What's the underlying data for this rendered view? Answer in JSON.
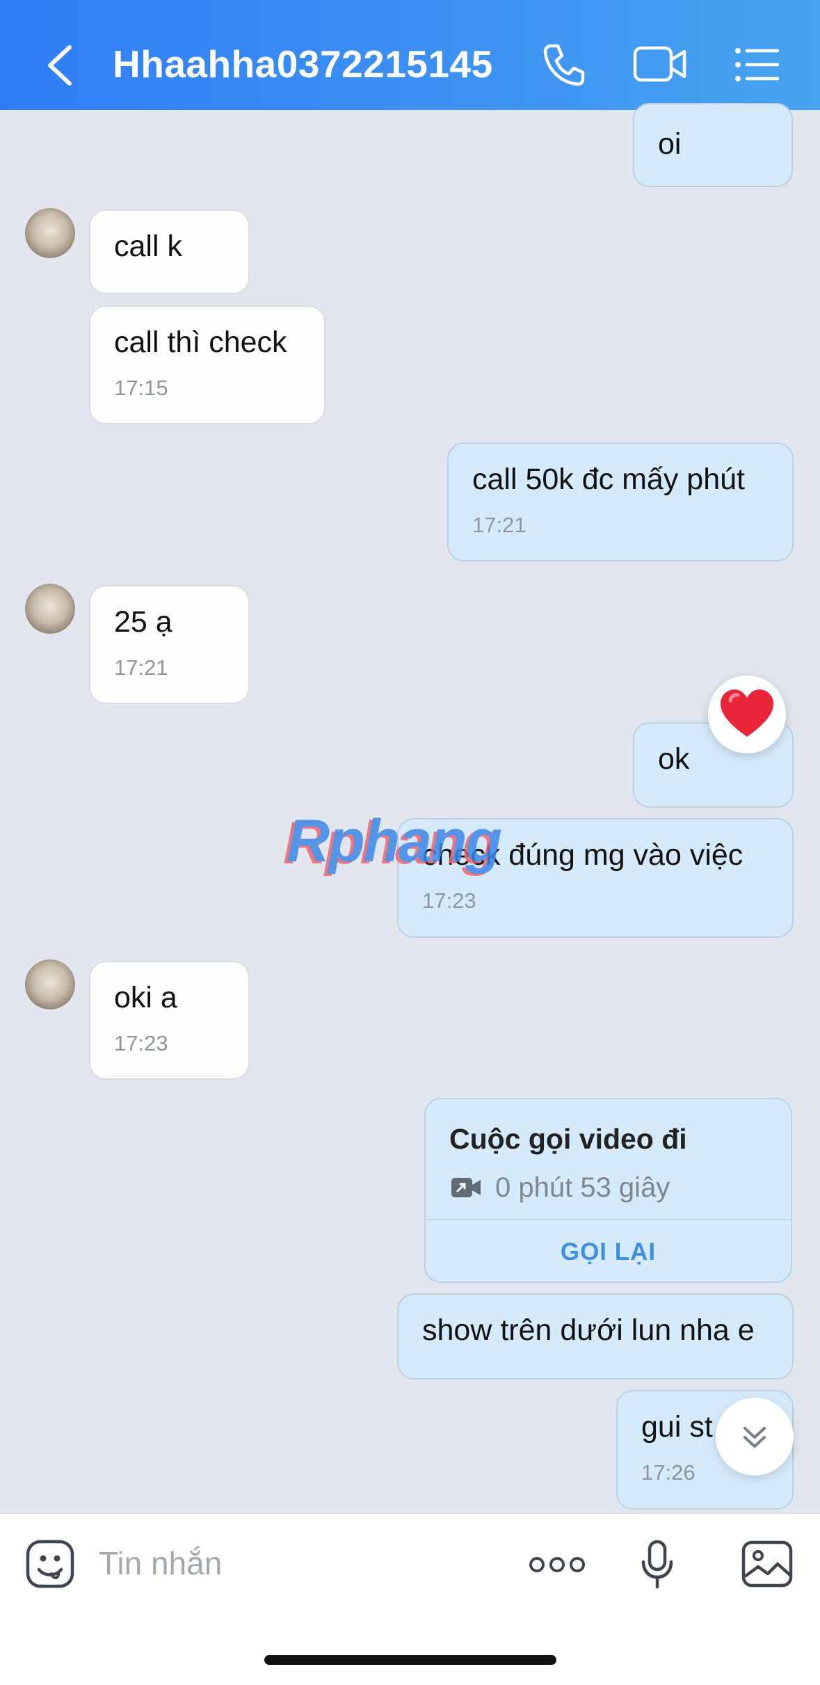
{
  "header": {
    "title": "Hhaahha0372215145",
    "icons": [
      "back-chevron-icon",
      "phone-icon",
      "video-call-icon",
      "menu-list-icon"
    ],
    "gradient": [
      "#2f7df6",
      "#48a2f0"
    ]
  },
  "messages": [
    {
      "direction": "sent",
      "text": "oi",
      "time": ""
    },
    {
      "direction": "received",
      "text": "call k",
      "time": ""
    },
    {
      "direction": "received",
      "text": "call thì check",
      "time": "17:15"
    },
    {
      "direction": "sent",
      "text": "call 50k đc mấy phút",
      "time": "17:21"
    },
    {
      "direction": "received",
      "text": "25 ạ",
      "time": "17:21"
    },
    {
      "direction": "sent",
      "text": "ok",
      "time": "",
      "reaction": "heart"
    },
    {
      "direction": "sent",
      "text": "check đúng mg vào việc",
      "time": "17:23"
    },
    {
      "direction": "received",
      "text": "oki a",
      "time": "17:23"
    },
    {
      "direction": "sent",
      "text": "show trên dưới lun nha e",
      "time": ""
    },
    {
      "direction": "sent",
      "text": "gui st",
      "time": "17:26"
    }
  ],
  "call_card": {
    "title": "Cuộc gọi video đi",
    "duration": "0 phút 53 giây",
    "action": "GỌI LẠI"
  },
  "watermark": "Rphang",
  "input": {
    "placeholder": "Tin nhắn",
    "icons": [
      "sticker-icon",
      "more-icon",
      "microphone-icon",
      "image-icon"
    ]
  },
  "colors": {
    "sent_bubble": "#d5ebfc",
    "received_bubble": "#fefefe",
    "background": "#e2e6ee",
    "accent": "#3d8fe0"
  }
}
